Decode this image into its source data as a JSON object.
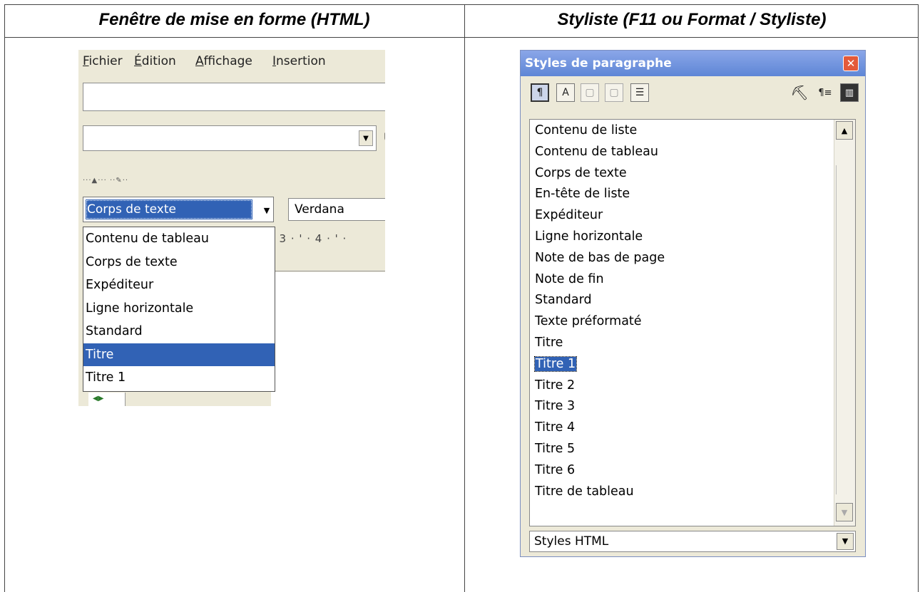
{
  "headers": {
    "left": "Fenêtre de mise en forme (HTML)",
    "right": "Styliste (F11 ou Format  / Styliste)"
  },
  "left_panel": {
    "menu": [
      {
        "underline": "F",
        "rest": "ichier"
      },
      {
        "underline": "É",
        "rest": "dition"
      },
      {
        "underline": "A",
        "rest": "ffichage"
      },
      {
        "underline": "I",
        "rest": "nsertion"
      }
    ],
    "combo_partial_text": "U",
    "style_combo_value": "Corps de texte",
    "font_combo_value": "Verdana",
    "ruler_text": "· 3 · ' · 4 · ' ·",
    "dropdown_items": [
      "Contenu de tableau",
      "Corps de texte",
      "Expéditeur",
      "Ligne horizontale",
      "Standard",
      "Titre",
      "Titre 1"
    ],
    "dropdown_selected": "Titre"
  },
  "right_panel": {
    "title": "Styles de paragraphe",
    "toolbar_icons": [
      "paragraph-styles-icon",
      "character-styles-icon",
      "frame-styles-icon",
      "page-styles-icon",
      "list-styles-icon",
      "fill-format-icon",
      "new-style-icon",
      "update-style-icon"
    ],
    "items": [
      "Contenu de liste",
      "Contenu de tableau",
      "Corps de texte",
      "En-tête de liste",
      "Expéditeur",
      "Ligne horizontale",
      "Note de bas de page",
      "Note de fin",
      "Standard",
      "Texte préformaté",
      "Titre",
      "Titre 1",
      "Titre 2",
      "Titre 3",
      "Titre 4",
      "Titre 5",
      "Titre 6",
      "Titre de tableau"
    ],
    "selected_item": "Titre 1",
    "filter_value": "Styles HTML"
  }
}
